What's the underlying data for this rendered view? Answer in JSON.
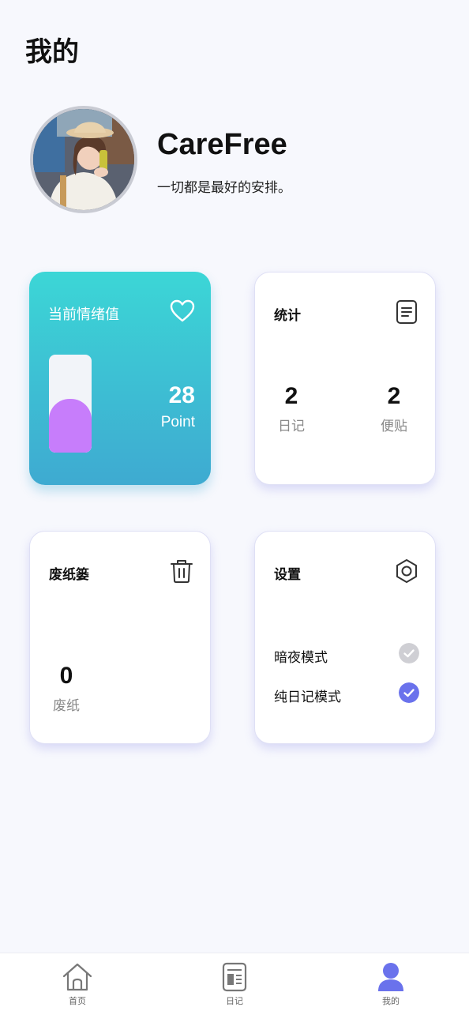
{
  "header": {
    "title": "我的"
  },
  "profile": {
    "name": "CareFree",
    "motto": "一切都是最好的安排。"
  },
  "mood_card": {
    "title": "当前情绪值",
    "value": "28",
    "unit": "Point",
    "level": 0.55,
    "fill_color": "#c77dfb"
  },
  "stats_card": {
    "title": "统计",
    "items": [
      {
        "value": "2",
        "label": "日记"
      },
      {
        "value": "2",
        "label": "便贴"
      }
    ]
  },
  "trash_card": {
    "title": "废纸篓",
    "value": "0",
    "label": "废纸"
  },
  "settings_card": {
    "title": "设置",
    "options": [
      {
        "label": "暗夜模式",
        "checked": false
      },
      {
        "label": "纯日记模式",
        "checked": true
      }
    ]
  },
  "bottom_nav": {
    "items": [
      {
        "label": "首页",
        "icon": "home-icon",
        "active": false
      },
      {
        "label": "日记",
        "icon": "diary-icon",
        "active": false
      },
      {
        "label": "我的",
        "icon": "user-icon",
        "active": true
      }
    ]
  },
  "colors": {
    "accent": "#6a72ec",
    "mood_gradient_top": "#3cd6d6",
    "mood_gradient_bottom": "#3eaad1",
    "unchecked": "#cfcfd4"
  }
}
